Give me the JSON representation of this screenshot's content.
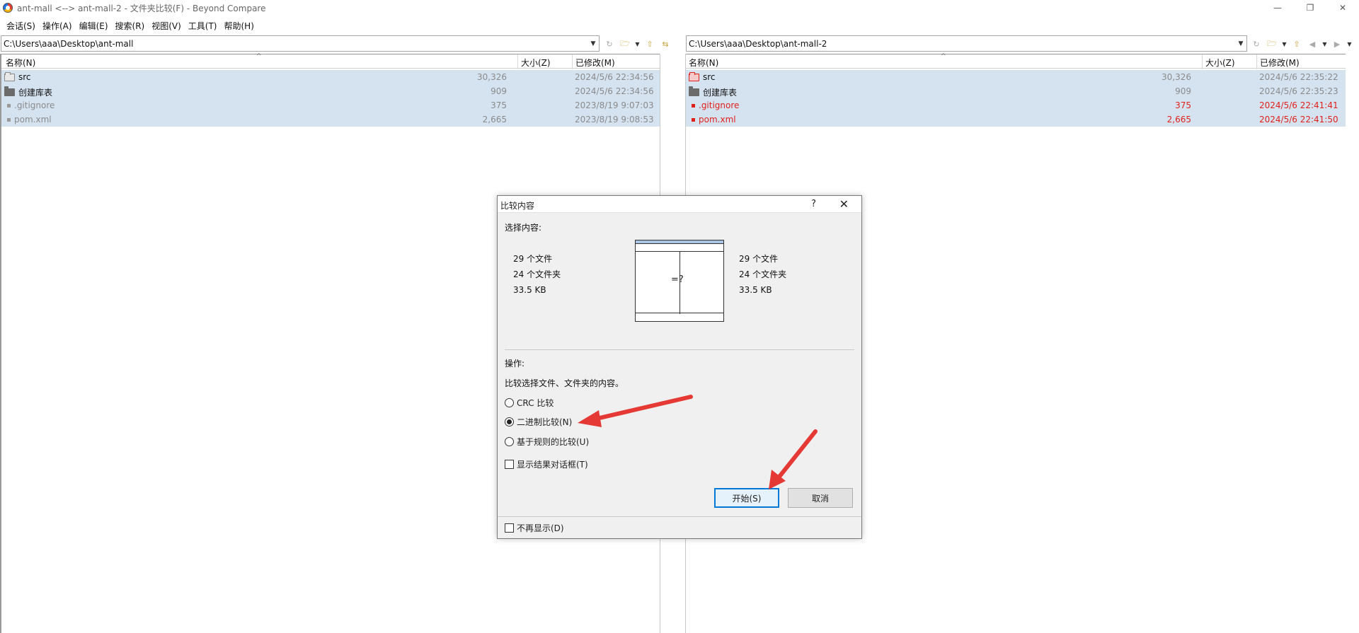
{
  "window": {
    "title": "ant-mall <--> ant-mall-2 - 文件夹比较(F) - Beyond Compare",
    "minimize": "—",
    "restore": "❐",
    "close": "✕"
  },
  "menu": [
    "会话(S)",
    "操作(A)",
    "编辑(E)",
    "搜索(R)",
    "视图(V)",
    "工具(T)",
    "帮助(H)"
  ],
  "left_path": "C:\\Users\\aaa\\Desktop\\ant-mall",
  "right_path": "C:\\Users\\aaa\\Desktop\\ant-mall-2",
  "columns": {
    "name": "名称(N)",
    "size": "大小(Z)",
    "modified": "已修改(M)"
  },
  "left_rows": [
    {
      "name": "src",
      "size": "30,326",
      "date": "2024/5/6 22:34:56"
    },
    {
      "name": "创建库表",
      "size": "909",
      "date": "2024/5/6 22:34:56"
    },
    {
      "name": ".gitignore",
      "size": "375",
      "date": "2023/8/19 9:07:03"
    },
    {
      "name": "pom.xml",
      "size": "2,665",
      "date": "2023/8/19 9:08:53"
    }
  ],
  "right_rows": [
    {
      "name": "src",
      "size": "30,326",
      "date": "2024/5/6 22:35:22"
    },
    {
      "name": "创建库表",
      "size": "909",
      "date": "2024/5/6 22:35:23"
    },
    {
      "name": ".gitignore",
      "size": "375",
      "date": "2024/5/6 22:41:41"
    },
    {
      "name": "pom.xml",
      "size": "2,665",
      "date": "2024/5/6 22:41:50"
    }
  ],
  "colors": {
    "diff": "#e0201b",
    "selection": "#d5e3f1",
    "accent": "#0078d7"
  },
  "dialog": {
    "title": "比较内容",
    "help": "?",
    "close": "✕",
    "select_label": "选择内容:",
    "left_stats": {
      "files": "29 个文件",
      "folders": "24 个文件夹",
      "size": "33.5 KB"
    },
    "right_stats": {
      "files": "29 个文件",
      "folders": "24 个文件夹",
      "size": "33.5 KB"
    },
    "graphic_symbol": "=?",
    "operation_label": "操作:",
    "operation_desc": "比较选择文件、文件夹的内容。",
    "options": [
      {
        "label": "CRC 比较",
        "selected": false
      },
      {
        "label": "二进制比较(N)",
        "selected": true
      },
      {
        "label": "基于规则的比较(U)",
        "selected": false
      }
    ],
    "show_results": "显示结果对话框(T)",
    "start_button": "开始(S)",
    "cancel_button": "取消",
    "dont_show_again": "不再显示(D)"
  }
}
